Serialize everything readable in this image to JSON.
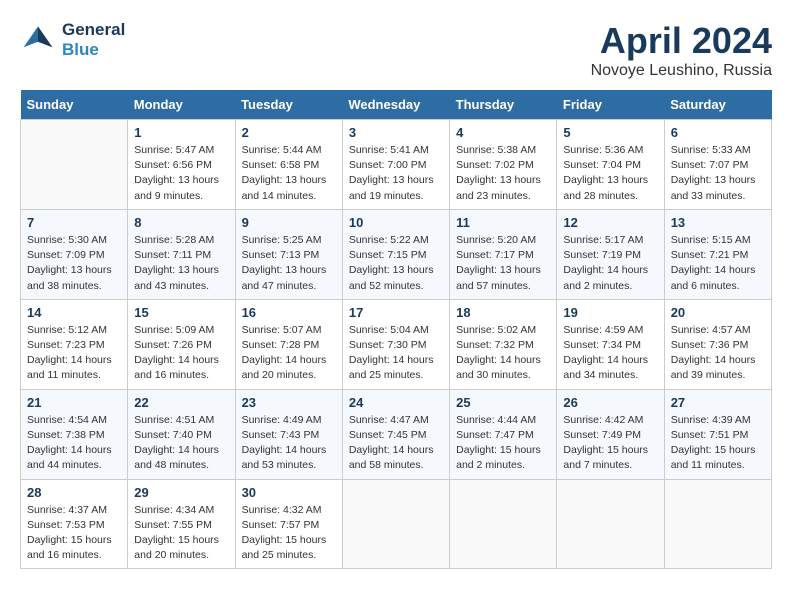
{
  "header": {
    "logo_line1": "General",
    "logo_line2": "Blue",
    "month": "April 2024",
    "location": "Novoye Leushino, Russia"
  },
  "weekdays": [
    "Sunday",
    "Monday",
    "Tuesday",
    "Wednesday",
    "Thursday",
    "Friday",
    "Saturday"
  ],
  "weeks": [
    [
      {
        "day": "",
        "info": ""
      },
      {
        "day": "1",
        "info": "Sunrise: 5:47 AM\nSunset: 6:56 PM\nDaylight: 13 hours\nand 9 minutes."
      },
      {
        "day": "2",
        "info": "Sunrise: 5:44 AM\nSunset: 6:58 PM\nDaylight: 13 hours\nand 14 minutes."
      },
      {
        "day": "3",
        "info": "Sunrise: 5:41 AM\nSunset: 7:00 PM\nDaylight: 13 hours\nand 19 minutes."
      },
      {
        "day": "4",
        "info": "Sunrise: 5:38 AM\nSunset: 7:02 PM\nDaylight: 13 hours\nand 23 minutes."
      },
      {
        "day": "5",
        "info": "Sunrise: 5:36 AM\nSunset: 7:04 PM\nDaylight: 13 hours\nand 28 minutes."
      },
      {
        "day": "6",
        "info": "Sunrise: 5:33 AM\nSunset: 7:07 PM\nDaylight: 13 hours\nand 33 minutes."
      }
    ],
    [
      {
        "day": "7",
        "info": "Sunrise: 5:30 AM\nSunset: 7:09 PM\nDaylight: 13 hours\nand 38 minutes."
      },
      {
        "day": "8",
        "info": "Sunrise: 5:28 AM\nSunset: 7:11 PM\nDaylight: 13 hours\nand 43 minutes."
      },
      {
        "day": "9",
        "info": "Sunrise: 5:25 AM\nSunset: 7:13 PM\nDaylight: 13 hours\nand 47 minutes."
      },
      {
        "day": "10",
        "info": "Sunrise: 5:22 AM\nSunset: 7:15 PM\nDaylight: 13 hours\nand 52 minutes."
      },
      {
        "day": "11",
        "info": "Sunrise: 5:20 AM\nSunset: 7:17 PM\nDaylight: 13 hours\nand 57 minutes."
      },
      {
        "day": "12",
        "info": "Sunrise: 5:17 AM\nSunset: 7:19 PM\nDaylight: 14 hours\nand 2 minutes."
      },
      {
        "day": "13",
        "info": "Sunrise: 5:15 AM\nSunset: 7:21 PM\nDaylight: 14 hours\nand 6 minutes."
      }
    ],
    [
      {
        "day": "14",
        "info": "Sunrise: 5:12 AM\nSunset: 7:23 PM\nDaylight: 14 hours\nand 11 minutes."
      },
      {
        "day": "15",
        "info": "Sunrise: 5:09 AM\nSunset: 7:26 PM\nDaylight: 14 hours\nand 16 minutes."
      },
      {
        "day": "16",
        "info": "Sunrise: 5:07 AM\nSunset: 7:28 PM\nDaylight: 14 hours\nand 20 minutes."
      },
      {
        "day": "17",
        "info": "Sunrise: 5:04 AM\nSunset: 7:30 PM\nDaylight: 14 hours\nand 25 minutes."
      },
      {
        "day": "18",
        "info": "Sunrise: 5:02 AM\nSunset: 7:32 PM\nDaylight: 14 hours\nand 30 minutes."
      },
      {
        "day": "19",
        "info": "Sunrise: 4:59 AM\nSunset: 7:34 PM\nDaylight: 14 hours\nand 34 minutes."
      },
      {
        "day": "20",
        "info": "Sunrise: 4:57 AM\nSunset: 7:36 PM\nDaylight: 14 hours\nand 39 minutes."
      }
    ],
    [
      {
        "day": "21",
        "info": "Sunrise: 4:54 AM\nSunset: 7:38 PM\nDaylight: 14 hours\nand 44 minutes."
      },
      {
        "day": "22",
        "info": "Sunrise: 4:51 AM\nSunset: 7:40 PM\nDaylight: 14 hours\nand 48 minutes."
      },
      {
        "day": "23",
        "info": "Sunrise: 4:49 AM\nSunset: 7:43 PM\nDaylight: 14 hours\nand 53 minutes."
      },
      {
        "day": "24",
        "info": "Sunrise: 4:47 AM\nSunset: 7:45 PM\nDaylight: 14 hours\nand 58 minutes."
      },
      {
        "day": "25",
        "info": "Sunrise: 4:44 AM\nSunset: 7:47 PM\nDaylight: 15 hours\nand 2 minutes."
      },
      {
        "day": "26",
        "info": "Sunrise: 4:42 AM\nSunset: 7:49 PM\nDaylight: 15 hours\nand 7 minutes."
      },
      {
        "day": "27",
        "info": "Sunrise: 4:39 AM\nSunset: 7:51 PM\nDaylight: 15 hours\nand 11 minutes."
      }
    ],
    [
      {
        "day": "28",
        "info": "Sunrise: 4:37 AM\nSunset: 7:53 PM\nDaylight: 15 hours\nand 16 minutes."
      },
      {
        "day": "29",
        "info": "Sunrise: 4:34 AM\nSunset: 7:55 PM\nDaylight: 15 hours\nand 20 minutes."
      },
      {
        "day": "30",
        "info": "Sunrise: 4:32 AM\nSunset: 7:57 PM\nDaylight: 15 hours\nand 25 minutes."
      },
      {
        "day": "",
        "info": ""
      },
      {
        "day": "",
        "info": ""
      },
      {
        "day": "",
        "info": ""
      },
      {
        "day": "",
        "info": ""
      }
    ]
  ]
}
